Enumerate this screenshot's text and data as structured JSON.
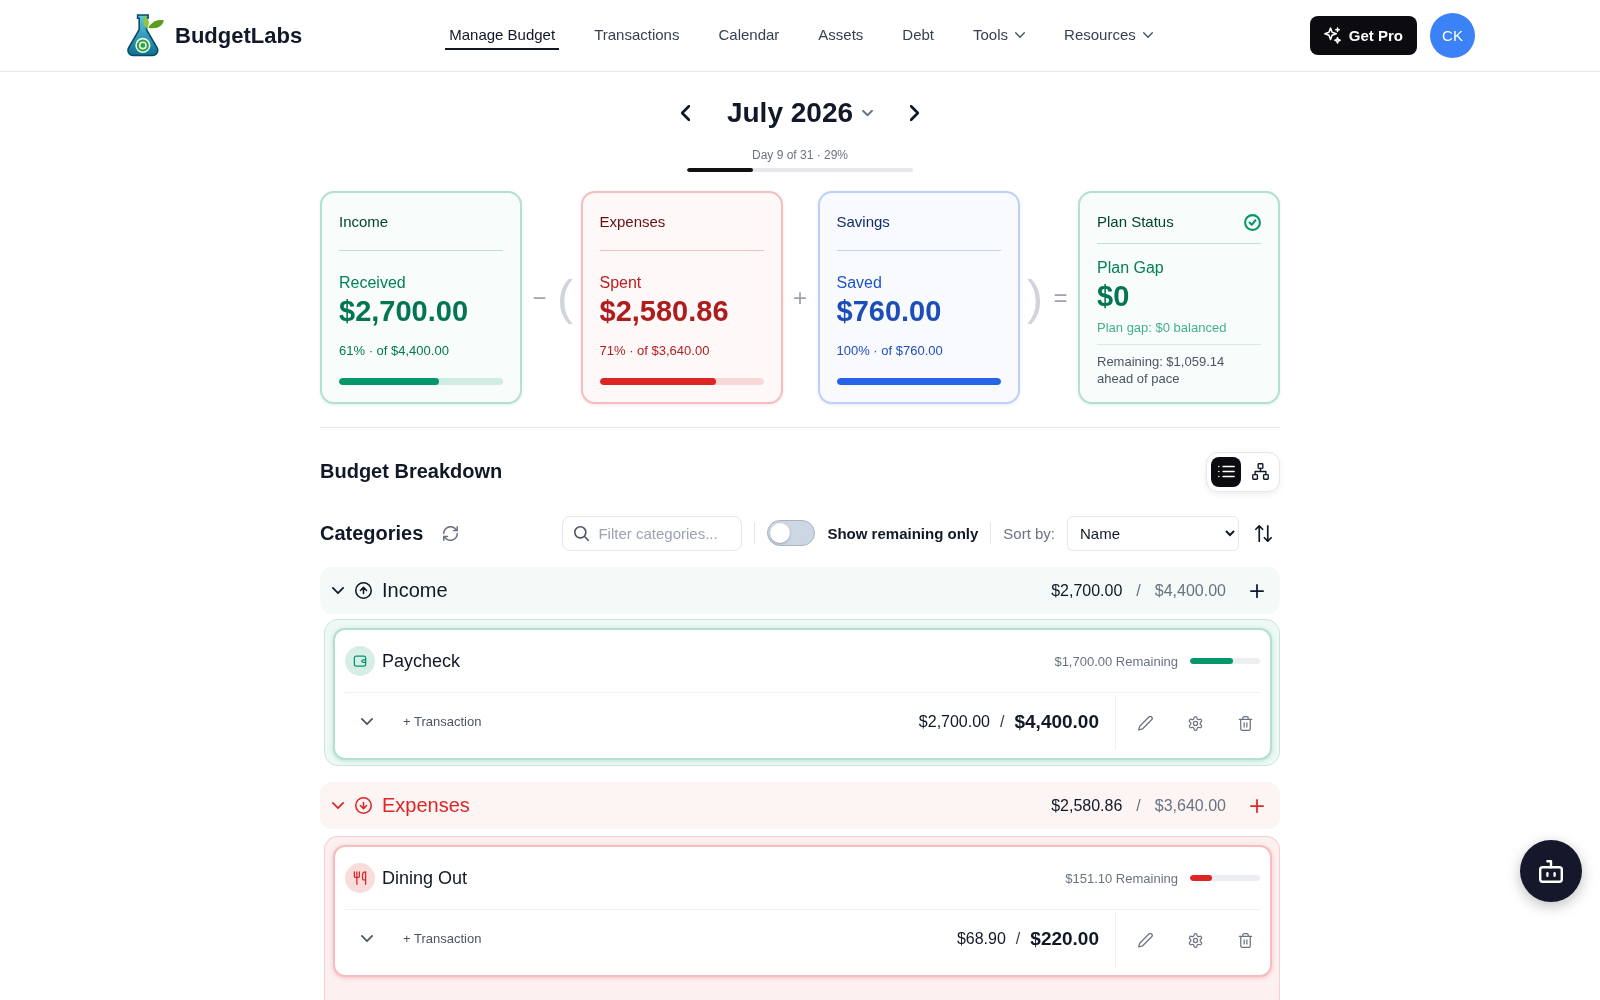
{
  "header": {
    "brand": "BudgetLabs",
    "nav": [
      {
        "label": "Manage Budget",
        "selected": true,
        "dropdown": false
      },
      {
        "label": "Transactions",
        "selected": false,
        "dropdown": false
      },
      {
        "label": "Calendar",
        "selected": false,
        "dropdown": false
      },
      {
        "label": "Assets",
        "selected": false,
        "dropdown": false
      },
      {
        "label": "Debt",
        "selected": false,
        "dropdown": false
      },
      {
        "label": "Tools",
        "selected": false,
        "dropdown": true
      },
      {
        "label": "Resources",
        "selected": false,
        "dropdown": true
      }
    ],
    "pro_button": "Get Pro",
    "avatar": "CK"
  },
  "month_nav": {
    "title": "July 2026",
    "progress_label": "Day 9 of 31 · 29%",
    "level": 0.29
  },
  "summary": [
    {
      "kind": "card",
      "title": "Income",
      "label": "Received",
      "amount": "$2,700.00",
      "detail": "61% · of $4,400.00",
      "level": 0.61,
      "color": "#059669"
    },
    {
      "kind": "operator",
      "symbol": "−"
    },
    {
      "kind": "bracket",
      "symbol": "("
    },
    {
      "kind": "card",
      "title": "Expenses",
      "label": "Spent",
      "amount": "$2,580.86",
      "detail": "71% · of $3,640.00",
      "level": 0.71,
      "color": "#dc2626"
    },
    {
      "kind": "operator",
      "symbol": "+"
    },
    {
      "kind": "card",
      "title": "Savings",
      "label": "Saved",
      "amount": "$760.00",
      "detail": "100% · of $760.00",
      "level": 1,
      "color": "#2563eb"
    },
    {
      "kind": "bracket",
      "symbol": ")"
    },
    {
      "kind": "operator",
      "symbol": "="
    },
    {
      "kind": "status",
      "title": "Plan Status",
      "label": "Plan Gap",
      "amount": "$0",
      "note": "Plan gap: $0 balanced",
      "detail": "Remaining: $1,059.14 ahead of pace",
      "color": "#059669"
    }
  ],
  "breakdown": {
    "title": "Budget Breakdown",
    "views": [
      {
        "kind": "list",
        "selected": true
      },
      {
        "kind": "tree",
        "selected": false
      }
    ]
  },
  "categories_toolbar": {
    "title": "Categories",
    "filter": {
      "placeholder": "Filter categories..."
    },
    "remaining_toggle": {
      "label": "Show remaining only",
      "on": false
    },
    "sort": {
      "label": "Sort by:",
      "value": "Name"
    }
  },
  "groups": [
    {
      "kind": "income",
      "name": "Income",
      "color": "#059669",
      "expanded": true,
      "actual": "$2,700.00",
      "separator": "/",
      "planned": "$4,400.00",
      "categories": [
        {
          "kind": "salary",
          "name": "Paycheck",
          "remaining": "$1,700.00 Remaining",
          "level": 0.61,
          "action": "+ Transaction",
          "actual": "$2,700.00",
          "separator": "/",
          "planned": "$4,400.00"
        }
      ]
    },
    {
      "kind": "expense",
      "name": "Expenses",
      "color": "#dc2626",
      "expanded": true,
      "actual": "$2,580.86",
      "separator": "/",
      "planned": "$3,640.00",
      "categories": [
        {
          "kind": "dining",
          "name": "Dining Out",
          "remaining": "$151.10 Remaining",
          "level": 0.31,
          "action": "+ Transaction",
          "actual": "$68.90",
          "separator": "/",
          "planned": "$220.00"
        }
      ]
    }
  ]
}
